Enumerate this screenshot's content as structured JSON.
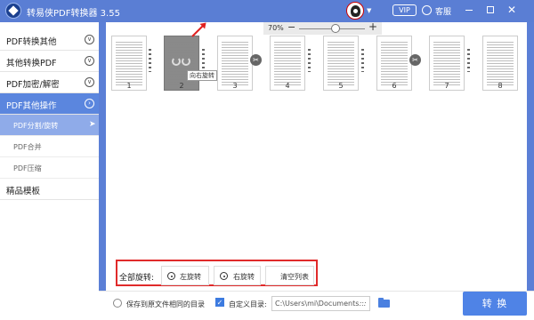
{
  "app": {
    "title": "转易侠PDF转换器 3.55",
    "vip": "VIP",
    "service": "客服"
  },
  "colors": {
    "titlebar": "#5a7ed4",
    "active_nav": "#5b86de",
    "active_sub": "#8fabe9",
    "highlight_box": "#e02a2a",
    "convert_button": "#4f83e6"
  },
  "sidebar": {
    "items": [
      {
        "label": "PDF转换其他",
        "icon": "chevron-down-icon"
      },
      {
        "label": "其他转换PDF",
        "icon": "chevron-down-icon"
      },
      {
        "label": "PDF加密/解密",
        "icon": "chevron-down-icon"
      },
      {
        "label": "PDF其他操作",
        "icon": "chevron-right-icon",
        "active": true
      }
    ],
    "sub_items": [
      {
        "label": "PDF分割/旋转",
        "active": true
      },
      {
        "label": "PDF合并"
      },
      {
        "label": "PDF压缩"
      }
    ],
    "templates": "精品模板"
  },
  "zoom": {
    "value": "70%",
    "minus": "−",
    "plus": "+"
  },
  "pages": [
    "1",
    "2",
    "3",
    "4",
    "5",
    "6",
    "7",
    "8"
  ],
  "tooltip": "向右旋转",
  "toolbar": {
    "all_rotate_label": "全部旋转:",
    "rotate_left": "左旋转",
    "rotate_right": "右旋转",
    "clear_list": "清空列表"
  },
  "footer": {
    "same_dir_label": "保存到原文件相同的目录",
    "custom_dir_label": "自定义目录:",
    "path_value": "C:\\Users\\mi\\Documents...",
    "path_dots": "...",
    "convert_label": "转 换"
  }
}
